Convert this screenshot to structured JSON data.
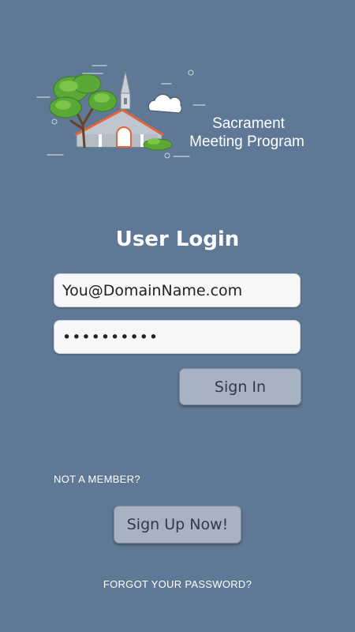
{
  "app": {
    "logo_line1": "Sacrament",
    "logo_line2": "Meeting Program",
    "logo_icon": "church-with-trees-illustration"
  },
  "login": {
    "title": "User Login",
    "email_value": "You@DomainName.com",
    "password_value": "••••••••••",
    "signin_label": "Sign In"
  },
  "signup": {
    "prompt": "NOT A MEMBER?",
    "button_label": "Sign Up Now!"
  },
  "forgot_label": "FORGOT YOUR PASSWORD?",
  "colors": {
    "background": "#5f7896",
    "button": "#a7b3c2",
    "field": "#f7f7f7",
    "text": "#ffffff"
  }
}
